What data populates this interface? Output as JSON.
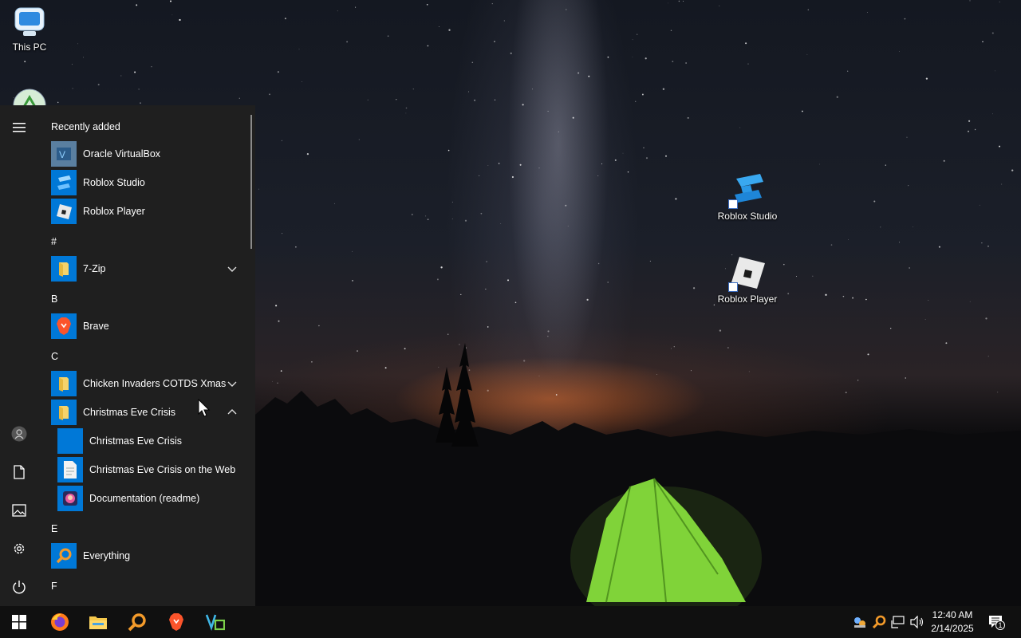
{
  "desktop": {
    "icons": [
      {
        "label": "This PC",
        "icon": "this-pc-icon"
      },
      {
        "label": "",
        "icon": "recycle-bin-icon"
      },
      {
        "label": "Roblox Studio",
        "icon": "roblox-studio-icon"
      },
      {
        "label": "Roblox Player",
        "icon": "roblox-player-icon"
      }
    ]
  },
  "start_menu": {
    "rail": {
      "menu": "hamburger-menu-icon",
      "user": "user-account-icon",
      "documents": "documents-icon",
      "pictures": "pictures-icon",
      "settings": "gear-icon",
      "power": "power-icon"
    },
    "sections": {
      "recently_added": "Recently added",
      "hash": "#",
      "b": "B",
      "c": "C",
      "e": "E",
      "f": "F"
    },
    "apps": {
      "virtualbox": "Oracle VirtualBox",
      "roblox_studio": "Roblox Studio",
      "roblox_player": "Roblox Player",
      "seven_zip": "7-Zip",
      "brave": "Brave",
      "chicken_invaders": "Chicken Invaders COTDS Xmas",
      "christmas_eve_crisis_folder": "Christmas Eve Crisis",
      "christmas_eve_crisis": "Christmas Eve Crisis",
      "christmas_eve_crisis_web": "Christmas Eve Crisis on the Web",
      "documentation": "Documentation (readme)",
      "everything": "Everything"
    }
  },
  "taskbar": {
    "pinned": [
      "windows-start-icon",
      "firefox-icon",
      "file-explorer-icon",
      "everything-search-icon",
      "brave-icon",
      "virtualbox-icon"
    ],
    "clock": {
      "time": "12:40 AM",
      "date": "2/14/2025"
    },
    "notifications_count": "1"
  },
  "colors": {
    "accent": "#0078d7",
    "start_bg": "#1f1f1f",
    "taskbar_bg": "#101010"
  }
}
